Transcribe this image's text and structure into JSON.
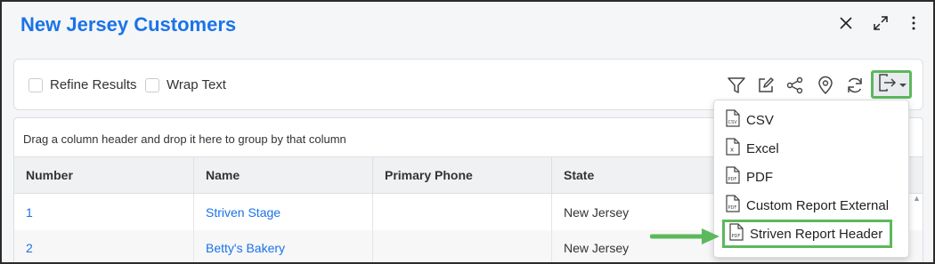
{
  "window": {
    "title": "New Jersey Customers",
    "close_icon": "close-icon",
    "expand_icon": "expand-icon",
    "more_icon": "kebab-menu-icon"
  },
  "toolbar": {
    "refine_results_label": "Refine Results",
    "wrap_text_label": "Wrap Text",
    "icons": [
      "filter-icon",
      "edit-icon",
      "share-icon",
      "location-pin-icon",
      "refresh-icon",
      "export-icon"
    ]
  },
  "grid": {
    "group_hint": "Drag a column header and drop it here to group by that column",
    "columns": [
      "Number",
      "Name",
      "Primary Phone",
      "State"
    ],
    "rows": [
      {
        "number": "1",
        "name": "Striven Stage",
        "phone": "",
        "state": "New Jersey"
      },
      {
        "number": "2",
        "name": "Betty's Bakery",
        "phone": "",
        "state": "New Jersey"
      }
    ]
  },
  "export_menu": {
    "items": [
      {
        "label": "CSV",
        "icon": "csv-file-icon"
      },
      {
        "label": "Excel",
        "icon": "excel-file-icon"
      },
      {
        "label": "PDF",
        "icon": "pdf-file-icon"
      },
      {
        "label": "Custom Report External",
        "icon": "pdf-file-icon"
      },
      {
        "label": "Striven Report Header",
        "icon": "pdf-file-icon"
      }
    ],
    "highlighted_item": "Striven Report Header"
  },
  "colors": {
    "title": "#1a73e8",
    "link": "#1a73e8",
    "highlight": "#5cb85c"
  }
}
